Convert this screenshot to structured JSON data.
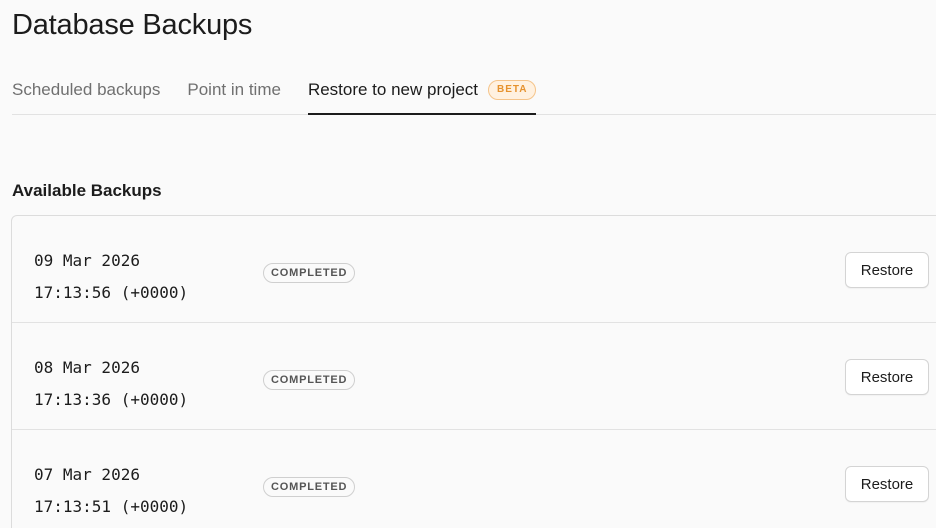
{
  "header": {
    "title": "Database Backups"
  },
  "tabs": [
    {
      "label": "Scheduled backups",
      "active": false
    },
    {
      "label": "Point in time",
      "active": false
    },
    {
      "label": "Restore to new project",
      "active": true,
      "badge": "BETA"
    }
  ],
  "main": {
    "section_title": "Available Backups",
    "restore_label": "Restore",
    "backups": [
      {
        "date": "09 Mar 2026",
        "time": "17:13:56 (+0000)",
        "status": "COMPLETED"
      },
      {
        "date": "08 Mar 2026",
        "time": "17:13:36 (+0000)",
        "status": "COMPLETED"
      },
      {
        "date": "07 Mar 2026",
        "time": "17:13:51 (+0000)",
        "status": "COMPLETED"
      }
    ]
  },
  "colors": {
    "accent_badge": "#e6922e",
    "active_tab_underline": "#1c1c1c",
    "muted_text": "#707070"
  }
}
